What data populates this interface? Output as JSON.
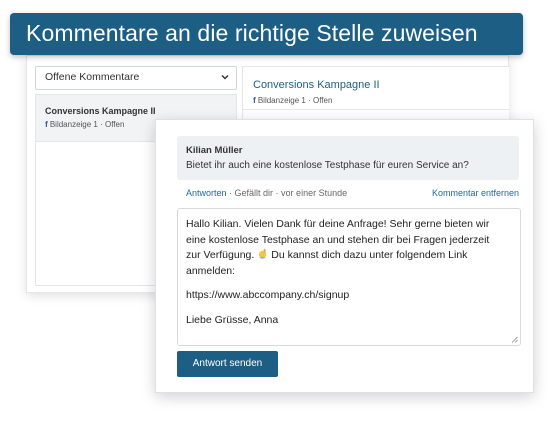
{
  "banner": {
    "title": "Kommentare an die richtige Stelle zuweisen"
  },
  "inbox": {
    "filter": {
      "selected": "Offene Kommentare"
    },
    "conversations": [
      {
        "title": "Conversions Kampagne II",
        "network_icon": "facebook-icon",
        "meta": "Bildanzeige 1 · Offen"
      }
    ],
    "detail": {
      "title": "Conversions Kampagne II",
      "network_icon": "facebook-icon",
      "meta": "Bildanzeige 1 · Offen"
    }
  },
  "comment": {
    "author": "Kilian Müller",
    "text": "Bietet ihr auch eine kostenlose Testphase für euren Service an?",
    "reply_label": "Antworten",
    "actions_meta": "· Gefällt dir · vor einer Stunde",
    "remove_label": "Kommentar entfernen"
  },
  "reply": {
    "lines": [
      "Hallo Kilian. Vielen Dank für deine Anfrage! Sehr gerne bieten wir",
      "eine kostenlose Testphase an und stehen dir bei Fragen jederzeit",
      "zur Verfügung.",
      "Du kannst dich dazu unter folgendem Link",
      "anmelden:",
      "https://www.abccompany.ch/signup",
      "Liebe Grüsse, Anna"
    ],
    "emoji": "raising-hand-emoji-icon",
    "send_label": "Antwort senden"
  },
  "colors": {
    "brand": "#1d5f84",
    "link": "#1d6a9c",
    "facebook": "#3b5998"
  }
}
